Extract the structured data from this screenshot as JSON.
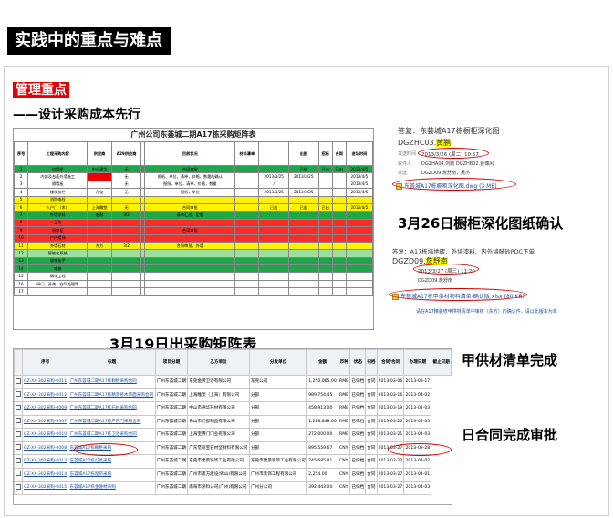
{
  "slide": {
    "title": "实践中的重点与难点",
    "section_badge": "管理重点",
    "subtitle": "——设计采购成本先行",
    "mid_caption": "3月19日出采购矩阵表",
    "label_supply": "甲供材清单完成",
    "label_contract": "日合同完成审批"
  },
  "matrix": {
    "title": "广州公司东荟城二期A17栋采购矩阵表",
    "headers": [
      "序号",
      "工程采购内容",
      "供应商",
      "A29供应商",
      "",
      "目前状况",
      "材料清单",
      "",
      "出图",
      "招标",
      "合同",
      "进场时间"
    ],
    "rows": [
      {
        "cls": "g",
        "c": [
          "1",
          "内墙柜",
          "中山通华",
          "无",
          "",
          "合同审批",
          "",
          "",
          "已出",
          "已出",
          "已出",
          "2013/4/5"
        ]
      },
      {
        "cls": "w",
        "c": [
          "2",
          "内部及台面外墙施工",
          "",
          "无",
          "",
          "图纸、单位，清单，价格，数量的确认",
          "",
          "2013/3/25",
          "2013/3/25",
          "",
          "",
          "2013/4/5"
        ],
        "red": 2
      },
      {
        "cls": "w",
        "c": [
          "3",
          "隔墙板",
          "",
          "无",
          "",
          "图纸，单位，清单，价格，数量",
          "",
          "/",
          "",
          "",
          "",
          "2013/4/5"
        ]
      },
      {
        "cls": "w",
        "c": [
          "4",
          "楼梯扶栏",
          "凡宝",
          "无",
          "",
          "图纸，单位",
          "",
          "2013/3/25",
          "2013/3/25",
          "",
          "",
          "2013/4/5"
        ]
      },
      {
        "cls": "y",
        "c": [
          "5",
          "消防电栓",
          "",
          "",
          "",
          "",
          "",
          "",
          "",
          "",
          "",
          ""
        ]
      },
      {
        "cls": "y",
        "c": [
          "6",
          "入户门（木）",
          "上海雕塑",
          "无",
          "",
          "合同审批",
          "",
          "已出",
          "已出",
          "已出",
          "",
          "2013/4/5"
        ]
      },
      {
        "cls": "g",
        "c": [
          "7",
          "外墙涂料",
          "宏耐",
          "3/2",
          "",
          "清单汇总，定版",
          "",
          "",
          "",
          "",
          "",
          ""
        ]
      },
      {
        "cls": "r",
        "c": [
          "8",
          "卫浴",
          "",
          "",
          "",
          "",
          "",
          "",
          "",
          "",
          "",
          ""
        ]
      },
      {
        "cls": "r",
        "c": [
          "9",
          "厨房柜",
          "",
          "",
          "",
          "合同审批",
          "",
          "",
          "",
          "",
          "",
          ""
        ]
      },
      {
        "cls": "r",
        "c": [
          "10",
          "户内楼梯",
          "",
          "",
          "",
          "",
          "",
          "",
          "",
          "",
          "",
          ""
        ]
      },
      {
        "cls": "y",
        "c": [
          "11",
          "外墙石材",
          "东方",
          "3/2",
          "",
          "合同审批，外墙",
          "",
          "",
          "",
          "",
          "",
          ""
        ]
      },
      {
        "cls": "gl",
        "c": [
          "12",
          "智能化系统",
          "",
          "",
          "",
          "",
          "",
          "",
          "",
          "",
          "",
          ""
        ]
      },
      {
        "cls": "g",
        "c": [
          "13",
          "楼梯扶手",
          "",
          "",
          "",
          "",
          "",
          "",
          "",
          "",
          "",
          ""
        ]
      },
      {
        "cls": "g",
        "c": [
          "14",
          "电梯",
          "",
          "",
          "",
          "",
          "",
          "",
          "",
          "",
          "",
          ""
        ]
      },
      {
        "cls": "w",
        "c": [
          "15",
          "弱电工程",
          "",
          "",
          "",
          "",
          "",
          "",
          "",
          "",
          "",
          ""
        ]
      },
      {
        "cls": "w",
        "c": [
          "16",
          "阀门、开关、空气处理等",
          "",
          "",
          "",
          "",
          "",
          "",
          "",
          "",
          "",
          ""
        ]
      },
      {
        "cls": "w",
        "c": [
          "17",
          "",
          "",
          "",
          "",
          "",
          "",
          "",
          "",
          "",
          "",
          ""
        ]
      }
    ]
  },
  "drawing": {
    "top_title": "答复：东荟城A17栋橱柜深化图",
    "code1": "DGZHC03.",
    "code1_hl": "黄鹏",
    "sent": "发送时间",
    "sent_val": "2013/3/26 (周二) 10:57",
    "recv": "收件人",
    "recv_val": "DGZHA04.刘鹏  DGZHB02.曹博风",
    "cc": "抄送",
    "cc_val": "DGZD09.詹舒南，吴杰",
    "att1": "东荟城A17栋橱柜深化图.dwg (3 MB)",
    "big1": "3月26日橱柜深化图纸确认",
    "reply2": "答复：A17栋墙地砖、外墙漆料、内外墙腻砂PDC下单",
    "code2": "DGZD09.",
    "code2_hl": "詹舒南",
    "sent2_val": "2013/3/27 (周三) 11:20",
    "recv2_val": "DGZD09.詹舒南",
    "att2": "东荟城A17栋甲供材物料清单-确认版.xlsx (80 KB)",
    "note": "请在A17精装修甲供材清单中审核（东方）的确认件，请以此版本为准"
  },
  "list": {
    "headers": [
      "",
      "序号",
      "标题",
      "项目分期",
      "乙方单位",
      "分发单位",
      "金额",
      "币种",
      "状态",
      "归档",
      "合同/合同",
      "办理日期",
      "截止日期"
    ],
    "rows": [
      [
        "GZ-XX-302采购-0011",
        "广州东荟城二期A17栋橱柜采购合同",
        "广州东荟城二期",
        "东莞金牌卫浴有限公司",
        "东莞公司",
        "1,250,065.00",
        "RMB",
        "已归档",
        "合同",
        "2013-03-06",
        "2013-03-17"
      ],
      [
        "GZ-XX-302采购-0012",
        "广州东荟城二期A17栋精装修木饰面采购合同",
        "广州东荟城二期",
        "上海雕塑（上海）有限公司",
        "分部",
        "989,754.45",
        "RMB",
        "已归档",
        "合同",
        "2013-03-16",
        "2013-04-02"
      ],
      [
        "GZ-XX-302采购-0009",
        "广州东荟城二期A17栋石材采购合同",
        "广州东荟城二期",
        "中山市通华石材有限公司",
        "分部",
        "458,913.00",
        "RMB",
        "已归档",
        "合同",
        "2013-03-19",
        "2013-04-03"
      ],
      [
        "GZ-XX-302采购-0007",
        "广州东荟城二期A17栋户内门采购合同",
        "广州东荟城二期",
        "佛山市门窗制品有限公司",
        "分部",
        "1,288,848.00",
        "RMB",
        "已归档",
        "合同",
        "2013-03-20",
        "2013-04-03"
      ],
      [
        "GZ-XX-302采购-0010",
        "广州东荟城二期A17栋卫浴采购合同",
        "广州东荟城二期",
        "上海宝腾门门业有限公司",
        "分部",
        "272,000.00",
        "RMB",
        "已归档",
        "合同",
        "2013-03-21",
        "2013-04-03"
      ],
      [
        "GZ-XX-302采购-0008",
        "东荟城A17栋橱柜采购",
        "广州东荟城二期",
        "广东堡丽宝石材坚材料有限公司",
        "分部",
        "895,559.67",
        "CNY",
        "已归档",
        "合同",
        "2013-03-27",
        "2013-03-28"
      ],
      [
        "GZ-XX-302采购-0013",
        "东荟城A17栋灯具采购",
        "广州东荟城二期",
        "东莞市建景装饰工业有限公司",
        "东莞市建景装饰工业有限公司",
        "745,685.81",
        "CNY",
        "已归档",
        "合同",
        "2013-03-27",
        "2013-04-02"
      ],
      [
        "GZ-XX-302采购-0014",
        "东荟城A17栋窗帘采购",
        "广州东荟城二期",
        "广州市南方建设(佛山)有限公司",
        "广州市装饰工程有限公司",
        "2,254.00",
        "CNY",
        "已归档",
        "合同",
        "2013-03-27",
        "2013-04-01"
      ],
      [
        "GZ-XX-302采购-0015",
        "东荟城A17栋金融材采购",
        "广州东荟城二期",
        "南海市涂料公司(广州)有限公司",
        "广州分公司",
        "392,443.00",
        "CNY",
        "已归档",
        "合同",
        "2013-03-27",
        "2013-04-03"
      ]
    ]
  },
  "colors": {
    "accent": "#e60000",
    "green": "#1fa64a",
    "yellow": "#fff200",
    "red": "#ff2a2a"
  }
}
